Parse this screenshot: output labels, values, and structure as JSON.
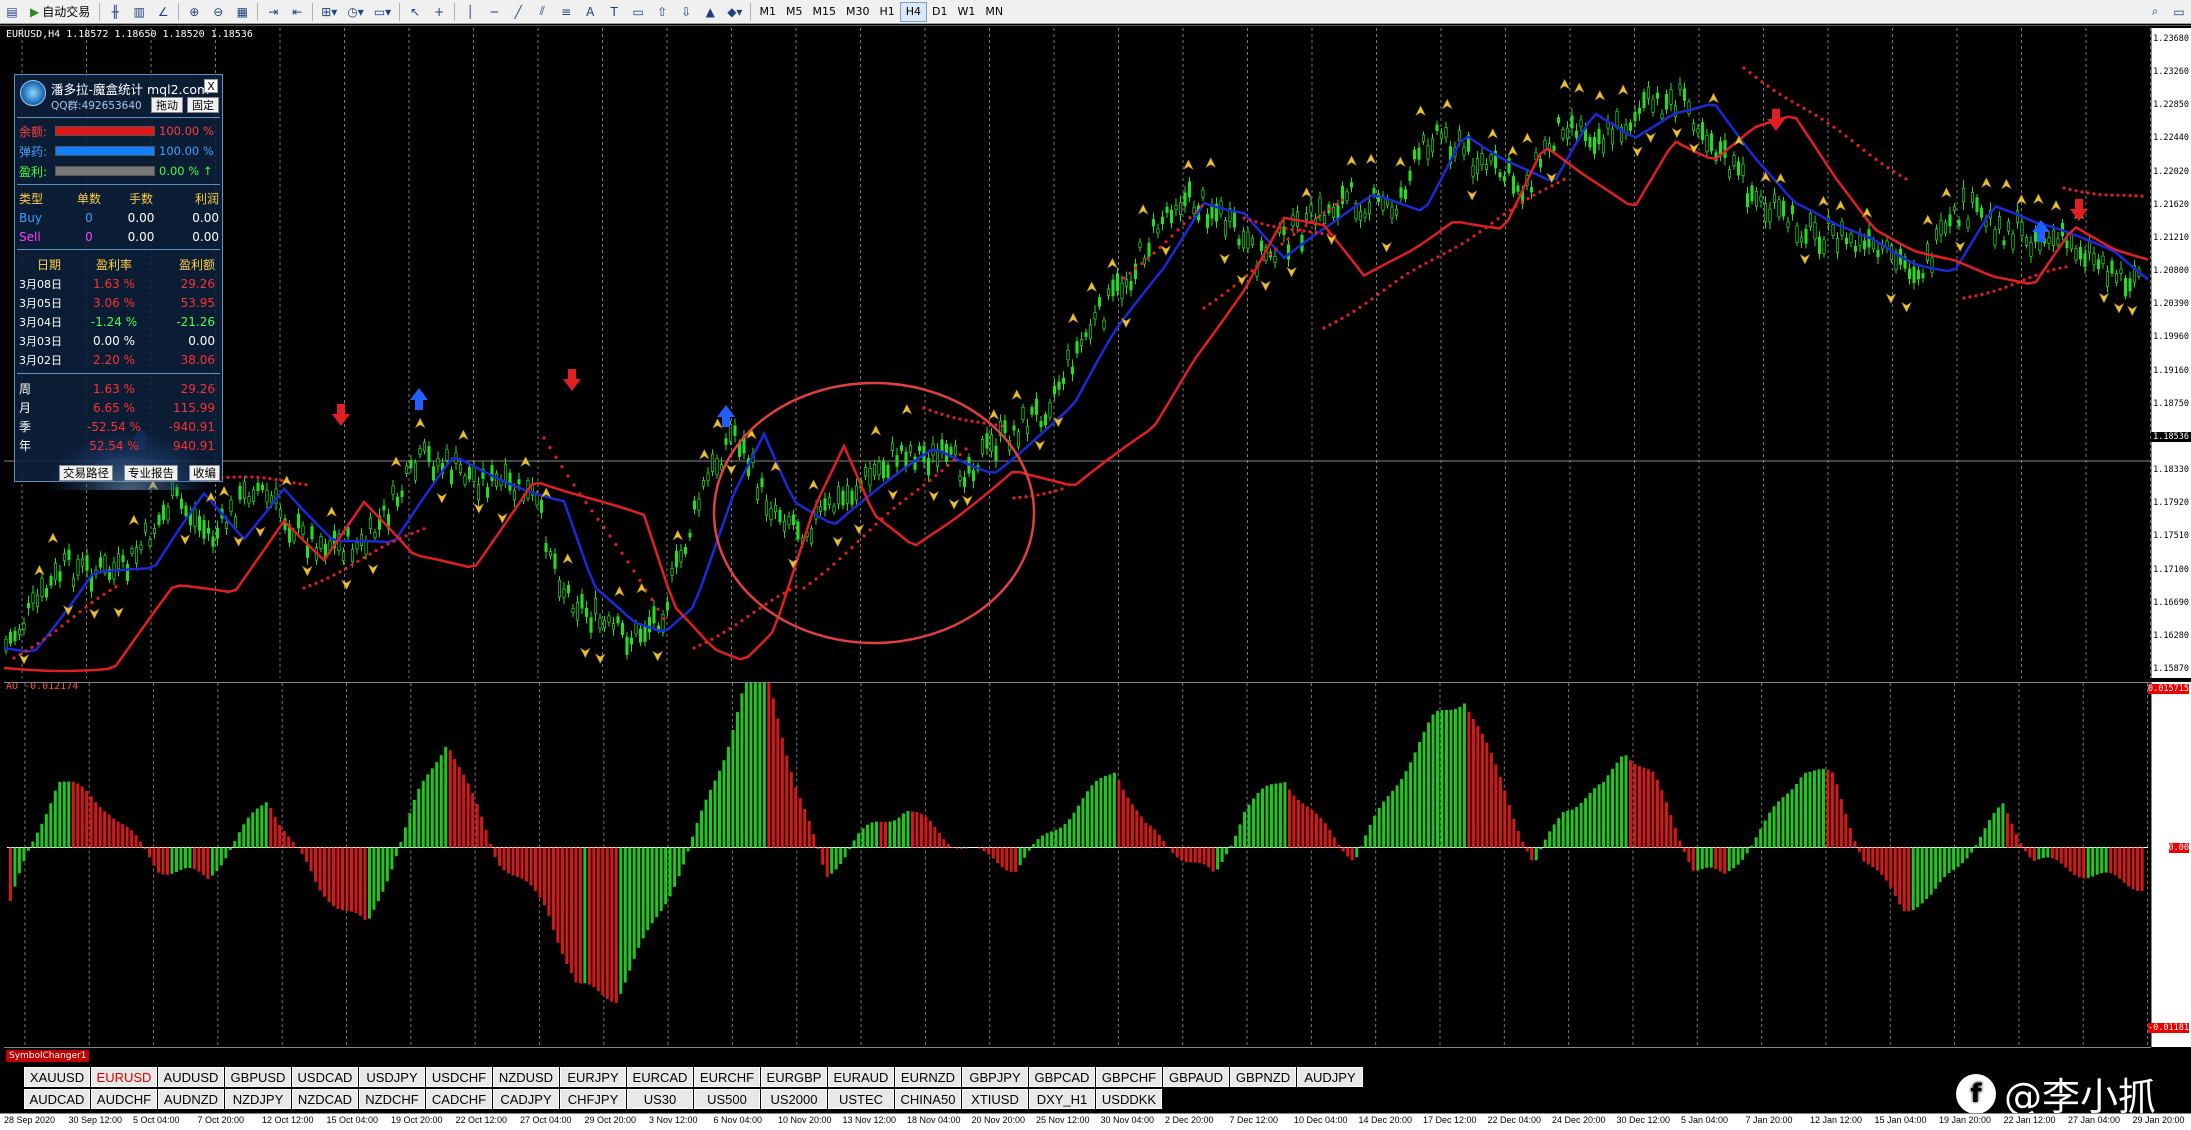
{
  "toolbar": {
    "autotrade_label": "自动交易",
    "timeframes": [
      "M1",
      "M5",
      "M15",
      "M30",
      "H1",
      "H4",
      "D1",
      "W1",
      "MN"
    ],
    "active_timeframe": "H4"
  },
  "chart": {
    "title": "EURUSD,H4  1.18572 1.18650 1.18520 1.18536",
    "price_labels": [
      "1.23680",
      "1.23260",
      "1.22850",
      "1.22440",
      "1.22020",
      "1.21620",
      "1.21210",
      "1.20800",
      "1.20390",
      "1.19960",
      "1.19160",
      "1.18750",
      "1.18536",
      "1.18330",
      "1.17920",
      "1.17510",
      "1.17100",
      "1.16690",
      "1.16280",
      "1.15870"
    ],
    "current_price": "1.18536"
  },
  "ao": {
    "label": "AO -0.012174",
    "axis_top": "0.015715",
    "axis_zero": "0.00",
    "axis_bottom": "-0.01181",
    "axis_min": "0"
  },
  "info_panel": {
    "title": "潘多拉-魔盒统计 mql2.com",
    "close": "X",
    "qq": "QQ群:492653640",
    "drag_btn": "拖动",
    "fix_btn": "固定",
    "balance_label": "余额:",
    "balance_pct": "100.00 %",
    "ammo_label": "弹药:",
    "ammo_pct": "100.00 %",
    "profit_label": "盈利:",
    "profit_pct": "0.00 % ↑",
    "pos_headers": [
      "类型",
      "单数",
      "手数",
      "利润"
    ],
    "positions": [
      {
        "type": "Buy",
        "count": "0",
        "lots": "0.00",
        "profit": "0.00"
      },
      {
        "type": "Sell",
        "count": "0",
        "lots": "0.00",
        "profit": "0.00"
      }
    ],
    "day_headers": [
      "日期",
      "盈利率",
      "盈利额"
    ],
    "days": [
      {
        "date": "3月08日",
        "rate": "1.63 %",
        "amount": "29.26",
        "color": "#ff3030"
      },
      {
        "date": "3月05日",
        "rate": "3.06 %",
        "amount": "53.95",
        "color": "#ff3030"
      },
      {
        "date": "3月04日",
        "rate": "-1.24 %",
        "amount": "-21.26",
        "color": "#4cff4c"
      },
      {
        "date": "3月03日",
        "rate": "0.00 %",
        "amount": "0.00",
        "color": "#ffffff"
      },
      {
        "date": "3月02日",
        "rate": "2.20 %",
        "amount": "38.06",
        "color": "#ff3030"
      }
    ],
    "periods": [
      {
        "label": "周",
        "rate": "1.63 %",
        "amount": "29.26"
      },
      {
        "label": "月",
        "rate": "6.65 %",
        "amount": "115.99"
      },
      {
        "label": "季",
        "rate": "-52.54 %",
        "amount": "-940.91"
      },
      {
        "label": "年",
        "rate": "52.54 %",
        "amount": "940.91"
      }
    ],
    "footer_buttons": [
      "交易路径",
      "专业报告",
      "收编"
    ]
  },
  "symbol_changer": {
    "title": "SymbolChanger1",
    "row1": [
      "XAUUSD",
      "EURUSD",
      "AUDUSD",
      "GBPUSD",
      "USDCAD",
      "USDJPY",
      "USDCHF",
      "NZDUSD",
      "EURJPY",
      "EURCAD",
      "EURCHF",
      "EURGBP",
      "EURAUD",
      "EURNZD",
      "GBPJPY",
      "GBPCAD",
      "GBPCHF",
      "GBPAUD",
      "GBPNZD",
      "AUDJPY"
    ],
    "row2": [
      "AUDCAD",
      "AUDCHF",
      "AUDNZD",
      "NZDJPY",
      "NZDCAD",
      "NZDCHF",
      "CADCHF",
      "CADJPY",
      "CHFJPY",
      "US30",
      "US500",
      "US2000",
      "USTEC",
      "CHINA50",
      "XTIUSD",
      "DXY_H1",
      "USDDKK"
    ],
    "active": "EURUSD"
  },
  "time_axis": [
    "28 Sep 2020",
    "30 Sep 12:00",
    "5 Oct 04:00",
    "7 Oct 20:00",
    "12 Oct 12:00",
    "15 Oct 04:00",
    "19 Oct 20:00",
    "22 Oct 12:00",
    "27 Oct 04:00",
    "29 Oct 20:00",
    "3 Nov 12:00",
    "6 Nov 04:00",
    "10 Nov 20:00",
    "13 Nov 12:00",
    "18 Nov 04:00",
    "20 Nov 20:00",
    "25 Nov 12:00",
    "30 Nov 04:00",
    "2 Dec 20:00",
    "7 Dec 12:00",
    "10 Dec 04:00",
    "14 Dec 20:00",
    "17 Dec 12:00",
    "22 Dec 04:00",
    "24 Dec 20:00",
    "30 Dec 12:00",
    "5 Jan 04:00",
    "7 Jan 20:00",
    "12 Jan 12:00",
    "15 Jan 04:00",
    "19 Jan 20:00",
    "22 Jan 12:00",
    "27 Jan 04:00",
    "29 Jan 20:00"
  ],
  "watermark": "@李小抓",
  "colors": {
    "candle": "#22dd22",
    "ma_blue": "#1a2ad8",
    "ma_red": "#e02020",
    "ao_up": "#1ec81e",
    "ao_down": "#d81818",
    "arrow": "#e8c030",
    "circle": "#e04040"
  }
}
